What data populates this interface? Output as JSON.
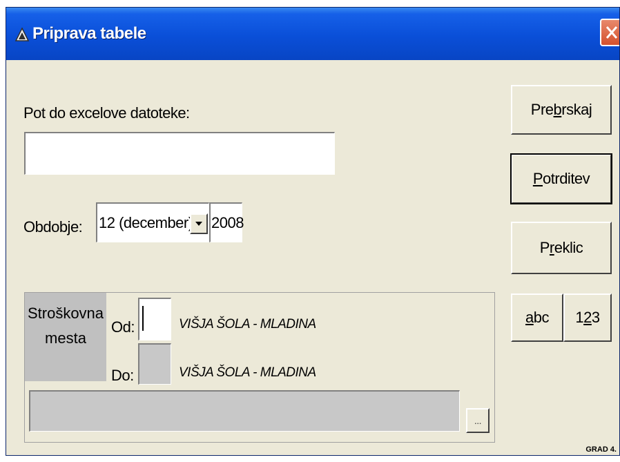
{
  "window": {
    "title": "Priprava tabele",
    "status_text": "GRAD 4."
  },
  "form": {
    "path_label": "Pot do excelove datoteke:",
    "path_value": "",
    "period_label": "Obdobje:",
    "month_selected": "12 (december)",
    "year_value": "2008"
  },
  "buttons": {
    "browse_pre": "Pre",
    "browse_u": "b",
    "browse_post": "rskaj",
    "confirm_u": "P",
    "confirm_post": "otrditev",
    "cancel_pre": "P",
    "cancel_u": "r",
    "cancel_post": "eklic",
    "abc_u": "a",
    "abc_post": "bc",
    "num_pre": "1",
    "num_u": "2",
    "num_post": "3",
    "ellipsis": "..."
  },
  "cost_centers": {
    "label_line1": "Stroškovna",
    "label_line2": "mesta",
    "from_label": "Od:",
    "from_name": "VIŠJA ŠOLA - MLADINA",
    "to_label": "Do:",
    "to_name": "VIŠJA ŠOLA - MLADINA"
  },
  "colors": {
    "titlebar": "#0a4fd8",
    "dialog_bg": "#ece9d8",
    "close_button": "#d4512d"
  }
}
